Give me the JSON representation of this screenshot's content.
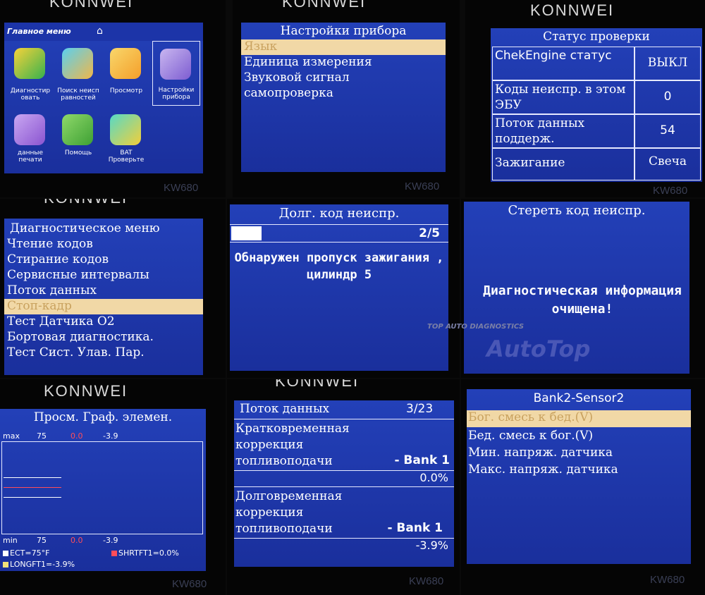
{
  "brand": "KONNWEI",
  "model": "KW680",
  "main_menu": {
    "title": "Главное меню",
    "items": [
      {
        "label": "Диагностир овать"
      },
      {
        "label": "Поиск неисп равностей"
      },
      {
        "label": "Просмотр"
      },
      {
        "label": "Настройки прибора"
      },
      {
        "label": "данные печати"
      },
      {
        "label": "Помощь"
      },
      {
        "label": "BAT Проверьте"
      }
    ]
  },
  "device_settings": {
    "title": "Настройки прибора",
    "items": [
      "Язык",
      "Единица измерения",
      "Звуковой сигнал",
      "самопроверка"
    ]
  },
  "check_status": {
    "title": "Статус проверки",
    "rows": [
      {
        "label": "ChekEngine статус",
        "value": "ВЫКЛ"
      },
      {
        "label": "Коды неиспр. в этом ЭБУ",
        "value": "0"
      },
      {
        "label": "Поток данных поддерж.",
        "value": "54"
      },
      {
        "label": "Зажигание",
        "value": "Свеча"
      }
    ]
  },
  "diag_menu": {
    "title": "Диагностическое меню",
    "items": [
      "Чтение кодов",
      "Стирание кодов",
      "Сервисные интервалы",
      "Поток данных",
      "Стоп-кадр",
      "Тест Датчика O2",
      "Бортовая диагностика.",
      "Тест Сист. Улав. Пар."
    ]
  },
  "pending_code": {
    "title": "Долг. код неиспр.",
    "counter": "2/5",
    "progress": 0.14,
    "message": "Обнаружен пропуск зажигания , цилиндр 5"
  },
  "erase_code": {
    "title": "Стереть код неиспр.",
    "message": "Диагностическая информация очищена!"
  },
  "watermark": {
    "tagline": "TOP AUTO DIAGNOSTICS",
    "logo": "AutoTop"
  },
  "graph_view": {
    "title": "Просм. Граф. элемен.",
    "max_label": "max",
    "min_label": "min",
    "max_values": [
      "75",
      "0.0",
      "-3.9"
    ],
    "min_values": [
      "75",
      "0.0",
      "-3.9"
    ],
    "legend": [
      {
        "label": "ECT=75°F",
        "color": "#ffffff"
      },
      {
        "label": "SHRTFT1=0.0%",
        "color": "#ff4d5a"
      },
      {
        "label": "LONGFT1=-3.9%",
        "color": "#f2e07a"
      }
    ],
    "colors": {
      "series1": "#ffffff",
      "series2": "#ff4d5a",
      "series3": "#f2e07a"
    }
  },
  "data_stream": {
    "title": "Поток данных",
    "counter": "3/23",
    "items": [
      {
        "label": "Кратковременная коррекция топливоподачи",
        "bank": "- Bank 1",
        "value": "0.0%"
      },
      {
        "label": "Долговременная коррекция топливоподачи",
        "bank": "- Bank 1",
        "value": "-3.9%"
      }
    ]
  },
  "sensor_menu": {
    "title": "Bank2-Sensor2",
    "items": [
      "Бог. смесь к бед.(V)",
      "Бед. смесь к бог.(V)",
      "Мин. напряж. датчика",
      "Макс. напряж. датчика"
    ]
  }
}
